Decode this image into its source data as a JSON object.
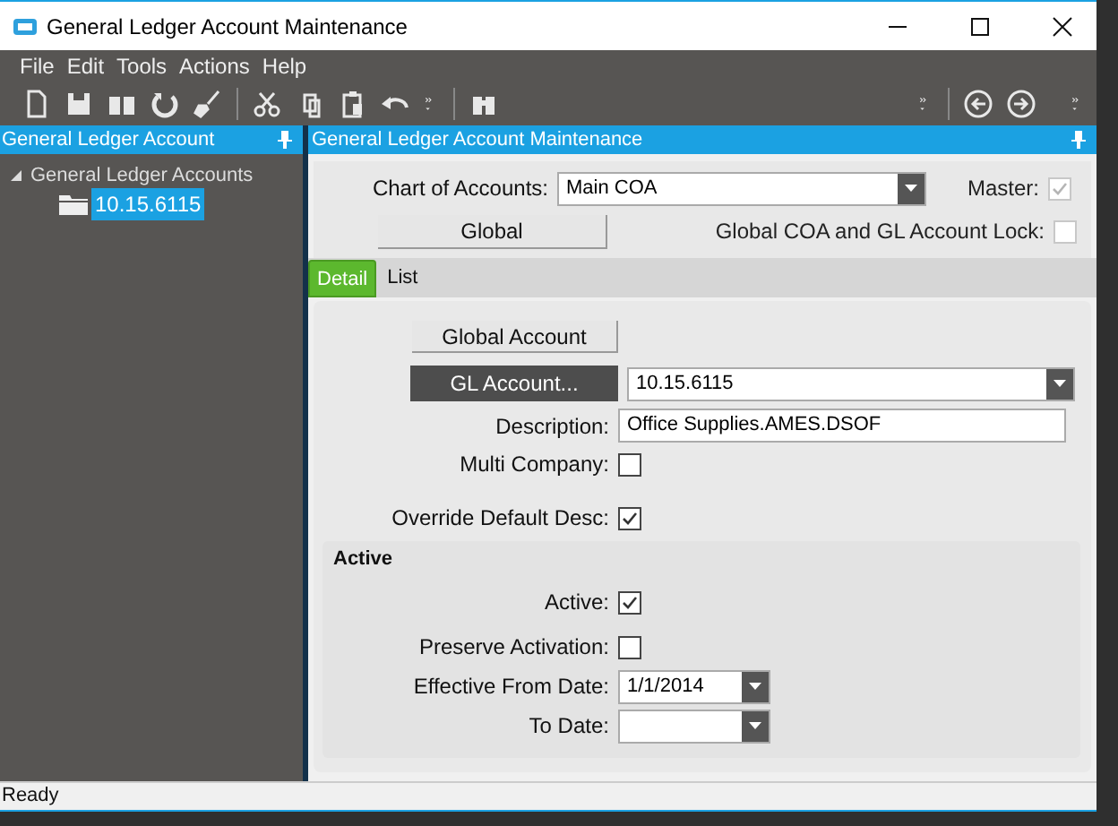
{
  "window": {
    "title": "General Ledger Account Maintenance"
  },
  "menu": [
    "File",
    "Edit",
    "Tools",
    "Actions",
    "Help"
  ],
  "left_panel": {
    "title": "General Ledger Account",
    "tree": [
      {
        "label": "General Ledger Accounts",
        "expanded": true,
        "children": [
          {
            "label": "10.15.6115",
            "selected": true
          }
        ]
      }
    ]
  },
  "right_panel": {
    "title": "General Ledger Account Maintenance"
  },
  "chart_of_accounts": {
    "label": "Chart of Accounts:",
    "value": "Main COA"
  },
  "master": {
    "label": "Master:",
    "checked": true,
    "disabled": true
  },
  "global_button": "Global",
  "lock": {
    "label": "Global COA and GL Account Lock:",
    "checked": false
  },
  "tabs": [
    {
      "label": "Detail",
      "selected": true
    },
    {
      "label": "List",
      "selected": false
    }
  ],
  "global_account_button": "Global Account",
  "gl_account": {
    "button": "GL Account...",
    "value": "10.15.6115"
  },
  "description": {
    "label": "Description:",
    "value": "Office Supplies.AMES.DSOF"
  },
  "options": [
    {
      "label": "Multi Company:",
      "checked": false
    },
    {
      "label": "Override Default Desc:",
      "checked": true
    }
  ],
  "active_group": {
    "title": "Active",
    "fields": [
      {
        "kind": "checkbox",
        "label": "Active:",
        "checked": true
      },
      {
        "kind": "checkbox",
        "label": "Preserve Activation:",
        "checked": false
      },
      {
        "kind": "date",
        "label": "Effective From Date:",
        "value": "1/1/2014"
      },
      {
        "kind": "date",
        "label": "To Date:"
      }
    ]
  },
  "status_bar": "Ready"
}
